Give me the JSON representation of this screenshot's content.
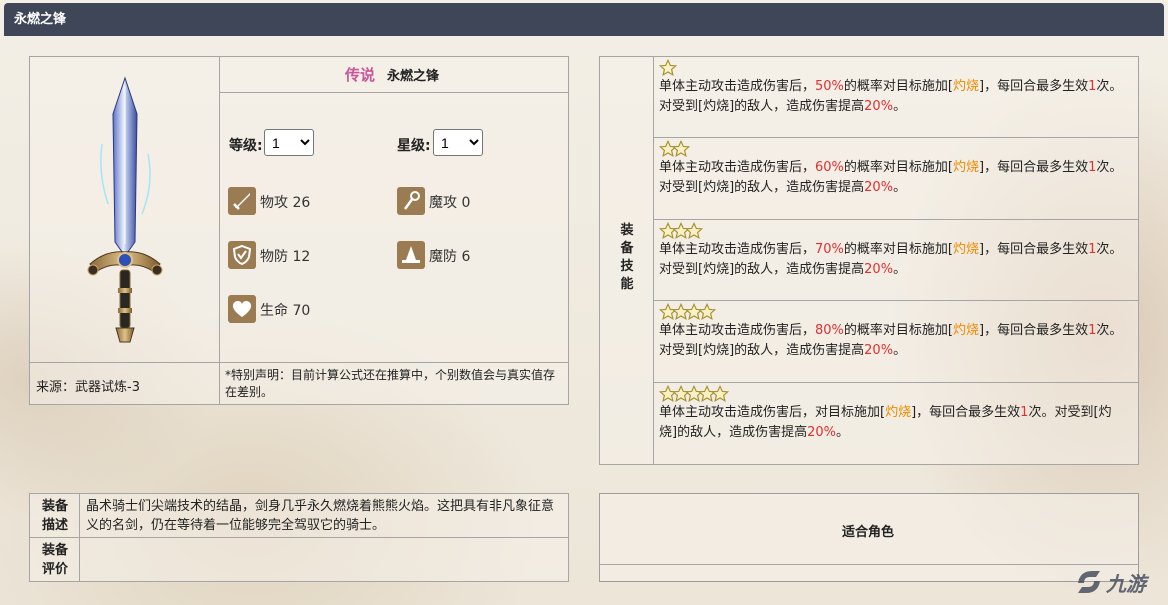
{
  "page": {
    "title": "永燃之锋"
  },
  "equip": {
    "rarity": "传说",
    "name": "永燃之锋",
    "level_label": "等级:",
    "level_value": "1",
    "star_label": "星级:",
    "star_value": "1",
    "stats": {
      "patk": "物攻 26",
      "matk": "魔攻 0",
      "pdef": "物防 12",
      "mdef": "魔防 6",
      "hp": "生命 70"
    },
    "source": "来源：武器试炼-3",
    "note": "*特别声明：目前计算公式还在推算中，个别数值会与真实值存在差别。"
  },
  "skills": {
    "header": "装备技能",
    "rows": [
      {
        "stars": 1,
        "p1": "单体主动攻击造成伤害后，",
        "rate": "50%",
        "p2": "的概率对目标施加[",
        "kw": "灼烧",
        "p3": "]，每回合最多生效",
        "n": "1",
        "p4": "次。对受到[灼烧]的敌人，造成伤害提高",
        "pct": "20%",
        "p5": "。"
      },
      {
        "stars": 2,
        "p1": "单体主动攻击造成伤害后，",
        "rate": "60%",
        "p2": "的概率对目标施加[",
        "kw": "灼烧",
        "p3": "]，每回合最多生效",
        "n": "1",
        "p4": "次。对受到[灼烧]的敌人，造成伤害提高",
        "pct": "20%",
        "p5": "。"
      },
      {
        "stars": 3,
        "p1": "单体主动攻击造成伤害后，",
        "rate": "70%",
        "p2": "的概率对目标施加[",
        "kw": "灼烧",
        "p3": "]，每回合最多生效",
        "n": "1",
        "p4": "次。对受到[灼烧]的敌人，造成伤害提高",
        "pct": "20%",
        "p5": "。"
      },
      {
        "stars": 4,
        "p1": "单体主动攻击造成伤害后，",
        "rate": "80%",
        "p2": "的概率对目标施加[",
        "kw": "灼烧",
        "p3": "]，每回合最多生效",
        "n": "1",
        "p4": "次。对受到[灼烧]的敌人，造成伤害提高",
        "pct": "20%",
        "p5": "。"
      },
      {
        "stars": 5,
        "p1": "单体主动攻击造成伤害后，对目标施加[",
        "kw": "灼烧",
        "p3": "]，每回合最多生效",
        "n": "1",
        "p4": "次。对受到[灼烧]的敌人，造成伤害提高",
        "pct": "20%",
        "p5": "。"
      }
    ]
  },
  "description": {
    "label": "装备描述",
    "text": "晶术骑士们尖端技术的结晶，剑身几乎永久燃烧着熊熊火焰。这把具有非凡象征意义的名剑，仍在等待着一位能够完全驾驭它的骑士。",
    "eval_label": "装备评价",
    "eval_text": ""
  },
  "suitable": {
    "label": "适合角色"
  },
  "watermark": {
    "text": "九游"
  },
  "colors": {
    "header": "#3e4658",
    "red": "#e03030",
    "orange": "#f08a00",
    "rarity": "#c7569a"
  }
}
